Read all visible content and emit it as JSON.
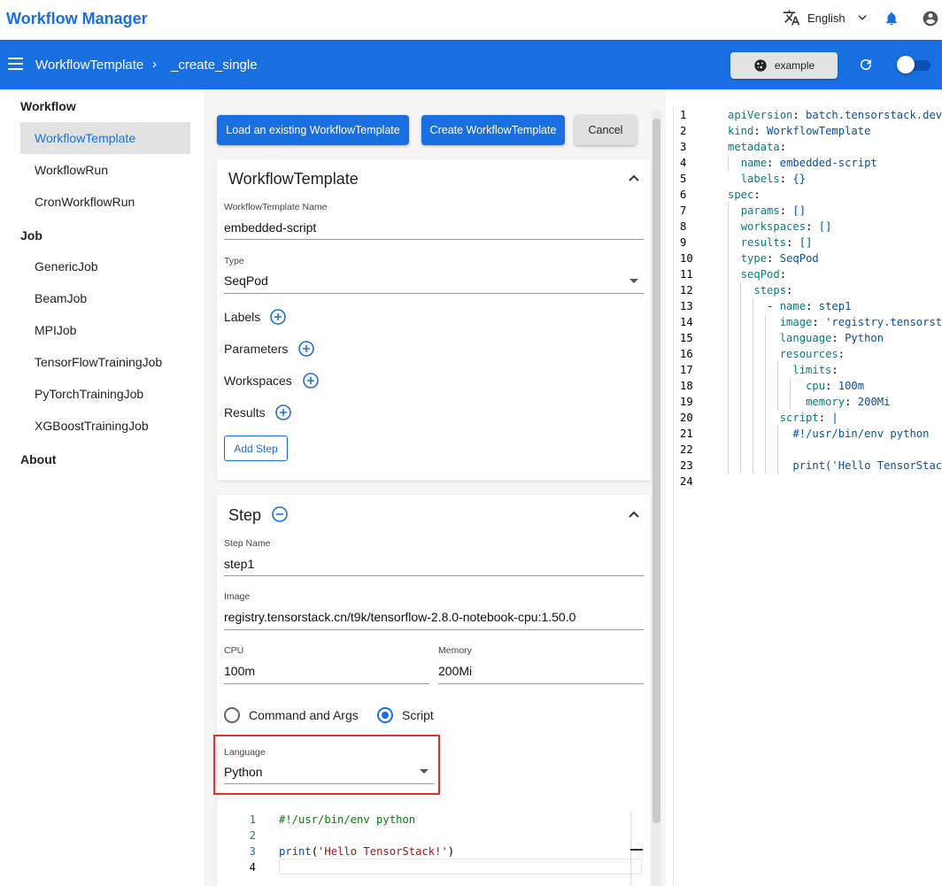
{
  "app": {
    "title": "Workflow Manager",
    "language": "English"
  },
  "toolbar": {
    "breadcrumb": [
      "WorkflowTemplate",
      "_create_single"
    ],
    "separator": "›",
    "example_label": "example"
  },
  "sidebar": {
    "sections": [
      {
        "title": "Workflow",
        "items": [
          "WorkflowTemplate",
          "WorkflowRun",
          "CronWorkflowRun"
        ]
      },
      {
        "title": "Job",
        "items": [
          "GenericJob",
          "BeamJob",
          "MPIJob",
          "TensorFlowTrainingJob",
          "PyTorchTrainingJob",
          "XGBoostTrainingJob"
        ]
      },
      {
        "title": "About",
        "items": []
      }
    ],
    "active_item": "WorkflowTemplate"
  },
  "actions": {
    "load_label": "Load an existing WorkflowTemplate",
    "create_label": "Create WorkflowTemplate",
    "cancel_label": "Cancel"
  },
  "template_card": {
    "title": "WorkflowTemplate",
    "name_label": "WorkflowTemplate Name",
    "name_value": "embedded-script",
    "type_label": "Type",
    "type_value": "SeqPod",
    "rows": [
      "Labels",
      "Parameters",
      "Workspaces",
      "Results"
    ],
    "add_step_label": "Add Step"
  },
  "step_card": {
    "title": "Step",
    "step_name_label": "Step Name",
    "step_name_value": "step1",
    "image_label": "Image",
    "image_value": "registry.tensorstack.cn/t9k/tensorflow-2.8.0-notebook-cpu:1.50.0",
    "cpu_label": "CPU",
    "cpu_value": "100m",
    "memory_label": "Memory",
    "memory_value": "200Mi",
    "radio_command": "Command and Args",
    "radio_script": "Script",
    "selected_mode": "Script",
    "language_label": "Language",
    "language_value": "Python",
    "script_lines": [
      "#!/usr/bin/env python",
      "",
      "print('Hello TensorStack!')",
      ""
    ]
  },
  "yaml": {
    "lines": [
      "apiVersion: batch.tensorstack.dev",
      "kind: WorkflowTemplate",
      "metadata:",
      "  name: embedded-script",
      "  labels: {}",
      "spec:",
      "  params: []",
      "  workspaces: []",
      "  results: []",
      "  type: SeqPod",
      "  seqPod:",
      "    steps:",
      "      - name: step1",
      "        image: 'registry.tensorst",
      "        language: Python",
      "        resources:",
      "          limits:",
      "            cpu: 100m",
      "            memory: 200Mi",
      "        script: |",
      "          #!/usr/bin/env python",
      "",
      "          print('Hello TensorStac",
      ""
    ]
  },
  "colors": {
    "primary": "#1a6fe0",
    "highlight": "#e53030"
  }
}
